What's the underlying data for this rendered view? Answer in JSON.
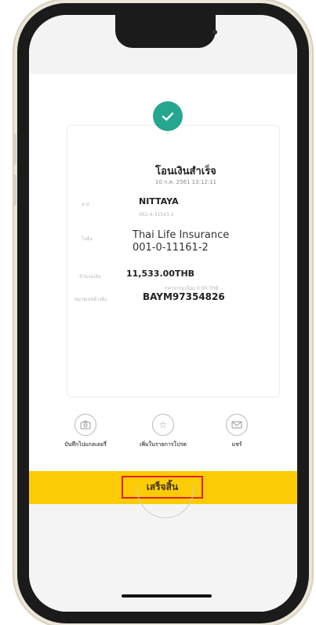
{
  "success": {
    "title": "โอนเงินสำเร็จ",
    "datetime": "10 ก.ค. 2561 13:12:11"
  },
  "transfer": {
    "from_label": "จาก",
    "from_name": "NITTAYA",
    "from_account": "062-4-31543-2",
    "to_label": "ไปยัง",
    "to_name": "Thai Life Insurance",
    "to_account": "001-0-11161-2",
    "amount_label": "จำนวนเงิน",
    "amount": "11,533.00THB",
    "fee": "+ค่าธรรมเนียม 0.00 THB",
    "ref_label": "หมายเลขอ้างอิง",
    "ref": "BAYM97354826"
  },
  "actions": [
    {
      "label": "บันทึกไปแกลเลอรี่",
      "icon": "camera-icon"
    },
    {
      "label": "เพิ่มในรายการโปรด",
      "icon": "star-icon"
    },
    {
      "label": "แชร์",
      "icon": "mail-icon"
    }
  ],
  "finish_button": {
    "label": "เสร็จสิ้น"
  },
  "colors": {
    "accent_green": "#27a68f",
    "bar_yellow": "#fbcc05",
    "highlight_red": "#e22026"
  }
}
